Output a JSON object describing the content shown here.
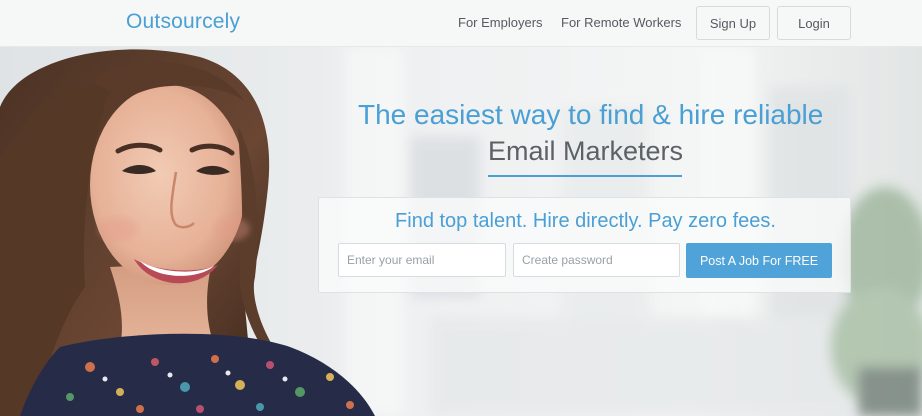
{
  "header": {
    "logo": "Outsourcely",
    "nav": [
      {
        "label": "For Employers"
      },
      {
        "label": "For Remote Workers"
      }
    ],
    "signup_label": "Sign Up",
    "login_label": "Login"
  },
  "hero": {
    "headline_line1": "The easiest way to find & hire reliable",
    "headline_line2": "Email Marketers",
    "tagline": "Find top talent. Hire directly. Pay zero fees.",
    "email_placeholder": "Enter your email",
    "password_placeholder": "Create password",
    "cta_label": "Post A Job For FREE"
  },
  "colors": {
    "brand_blue": "#4a9fd4",
    "button_blue": "#4fa3d9",
    "text_gray": "#555b61"
  }
}
